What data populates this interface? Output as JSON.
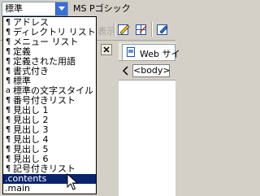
{
  "toolbar": {
    "style_value": "標準",
    "font_name": "MS Pゴシック",
    "hidden_label": "表示"
  },
  "document": {
    "tab_label": "Web サイ",
    "tag_selector": "<body>"
  },
  "style_list": {
    "items": [
      {
        "prefix": "¶",
        "label": "アドレス"
      },
      {
        "prefix": "¶",
        "label": "ディレクトリ リスト"
      },
      {
        "prefix": "¶",
        "label": "メニュー リスト"
      },
      {
        "prefix": "¶",
        "label": "定義"
      },
      {
        "prefix": "¶",
        "label": "定義された用語"
      },
      {
        "prefix": "¶",
        "label": "書式付き"
      },
      {
        "prefix": "¶",
        "label": "標準"
      },
      {
        "prefix": "a",
        "label": "標準の文字スタイル"
      },
      {
        "prefix": "¶",
        "label": "番号付きリスト"
      },
      {
        "prefix": "¶",
        "label": "見出し 1"
      },
      {
        "prefix": "¶",
        "label": "見出し 2"
      },
      {
        "prefix": "¶",
        "label": "見出し 3"
      },
      {
        "prefix": "¶",
        "label": "見出し 4"
      },
      {
        "prefix": "¶",
        "label": "見出し 5"
      },
      {
        "prefix": "¶",
        "label": "見出し 6"
      },
      {
        "prefix": "¶",
        "label": "記号付きリスト"
      },
      {
        "prefix": "",
        "label": ".contents"
      },
      {
        "prefix": "",
        "label": ".main"
      }
    ],
    "selected_label": ".contents"
  },
  "colors": {
    "selection": "#0a246a",
    "dropdown_button": "#3c6fd0",
    "chrome": "#d4d0c8"
  }
}
